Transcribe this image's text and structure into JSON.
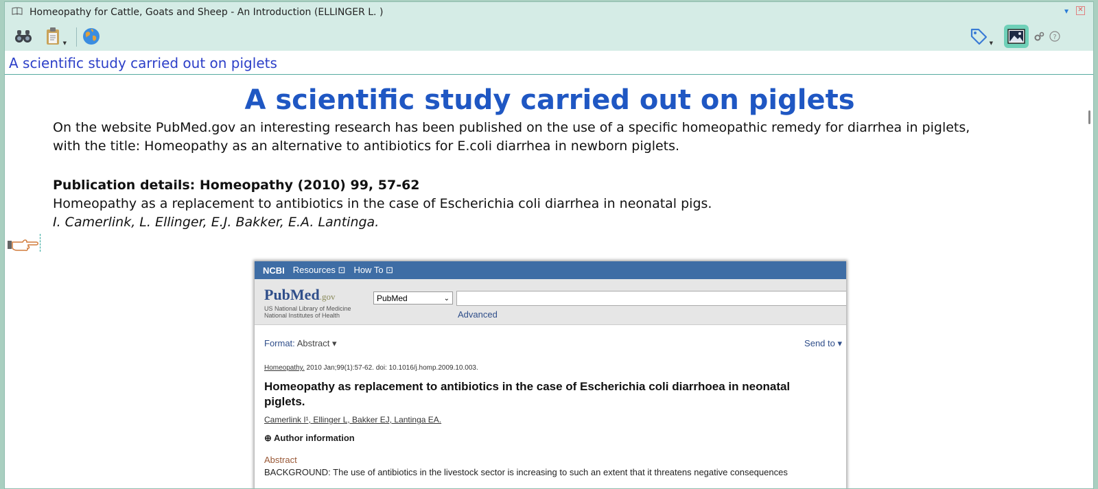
{
  "window": {
    "title": "Homeopathy for Cattle, Goats and Sheep - An Introduction (ELLINGER L. )",
    "minimize": "▾",
    "close": "✕"
  },
  "toolbar": {
    "left": [
      {
        "name": "binoculars-icon"
      },
      {
        "name": "clipboard-icon"
      },
      {
        "name": "globe-icon"
      }
    ],
    "right": [
      {
        "name": "tag-icon"
      },
      {
        "name": "image-icon",
        "active": true
      },
      {
        "name": "gear-icon"
      },
      {
        "name": "help-icon"
      }
    ]
  },
  "address": {
    "value": "A scientific study carried out on piglets"
  },
  "article": {
    "heading": "A scientific study carried out on piglets",
    "intro_line1": "On the website PubMed.gov an interesting research has been published on the use of a specific homeopathic remedy for diarrhea in piglets,",
    "intro_line2": "with the title: Homeopathy as an alternative to antibiotics for E.coli diarrhea in newborn piglets.",
    "pub_heading": "Publication details: Homeopathy (2010) 99, 57-62",
    "pub_title": "Homeopathy as a replacement to antibiotics in the case of Escherichia coli diarrhea in neonatal pigs.",
    "pub_authors": "I. Camerlink, L. Ellinger, E.J. Bakker, E.A. Lantinga."
  },
  "pubmed": {
    "ncbi": "NCBI",
    "resources": "Resources ⊡",
    "howto": "How To ⊡",
    "logo_pub": "PubMed",
    "logo_gov": ".gov",
    "sub1": "US National Library of Medicine",
    "sub2": "National Institutes of Health",
    "db_select": "PubMed",
    "advanced": "Advanced",
    "format_label": "Format:",
    "format_value": "Abstract ▾",
    "send_to": "Send to ▾",
    "journal": "Homeopathy.",
    "citation": " 2010 Jan;99(1):57-62. doi: 10.1016/j.homp.2009.10.003.",
    "title": "Homeopathy as replacement to antibiotics in the case of Escherichia coli diarrhoea in neonatal piglets.",
    "authors": "Camerlink I¹, Ellinger L, Bakker EJ, Lantinga EA.",
    "author_info": "⊕ Author information",
    "abstract_label": "Abstract",
    "background": "BACKGROUND: The use of antibiotics in the livestock sector is increasing to such an extent that it threatens negative consequences"
  },
  "colors": {
    "heading": "#1f57c3",
    "address_text": "#2c3fc8",
    "ncbi_bar": "#3e6da5",
    "window_bg": "#d5ece6"
  }
}
